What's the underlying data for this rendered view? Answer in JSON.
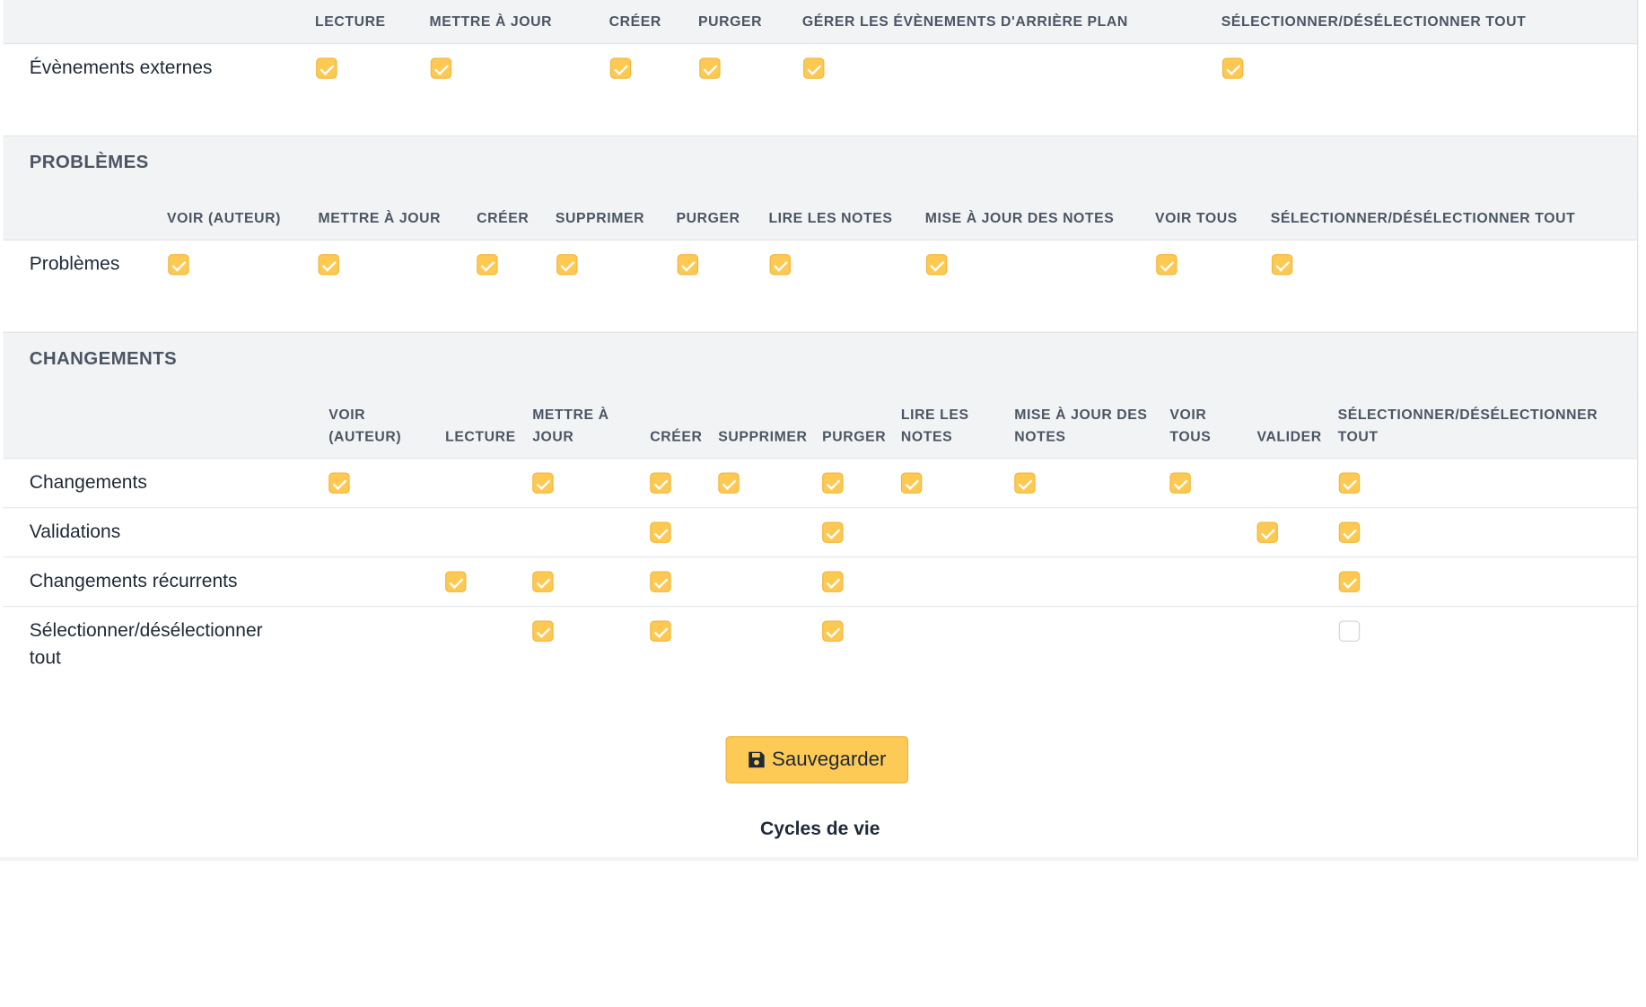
{
  "sections": {
    "external": {
      "columns": [
        "Lecture",
        "Mettre à jour",
        "Créer",
        "Purger",
        "Gérer les évènements d'arrière plan",
        "Sélectionner/désélectionner tout"
      ],
      "rows": [
        {
          "label": "Évènements externes",
          "checks": [
            true,
            true,
            true,
            true,
            true,
            true
          ]
        }
      ]
    },
    "problems": {
      "title": "PROBLÈMES",
      "columns": [
        "Voir (auteur)",
        "Mettre à jour",
        "Créer",
        "Supprimer",
        "Purger",
        "Lire les notes",
        "Mise à jour des notes",
        "Voir tous",
        "Sélectionner/désélectionner tout"
      ],
      "rows": [
        {
          "label": "Problèmes",
          "checks": [
            true,
            true,
            true,
            true,
            true,
            true,
            true,
            true,
            true
          ]
        }
      ]
    },
    "changes": {
      "title": "CHANGEMENTS",
      "columns": [
        [
          "Voir",
          "(auteur)"
        ],
        [
          "",
          "Lecture"
        ],
        [
          "Mettre à",
          "jour"
        ],
        [
          "",
          "Créer"
        ],
        [
          "",
          "Supprimer"
        ],
        [
          "",
          "Purger"
        ],
        [
          "Lire les",
          "notes"
        ],
        [
          "Mise à jour des",
          "notes"
        ],
        [
          "Voir",
          "tous"
        ],
        [
          "",
          "Valider"
        ],
        [
          "Sélectionner/désélectionner",
          "tout"
        ]
      ],
      "rows": [
        {
          "label": "Changements",
          "checks": [
            true,
            null,
            true,
            true,
            true,
            true,
            true,
            true,
            true,
            null,
            true
          ]
        },
        {
          "label": "Validations",
          "checks": [
            null,
            null,
            null,
            true,
            null,
            true,
            null,
            null,
            null,
            true,
            true
          ]
        },
        {
          "label": "Changements récurrents",
          "checks": [
            null,
            true,
            true,
            true,
            null,
            true,
            null,
            null,
            null,
            null,
            true
          ]
        },
        {
          "label": "Sélectionner/désélectionner tout",
          "label_lines": [
            "Sélectionner/désélectionner",
            "tout"
          ],
          "checks": [
            null,
            null,
            true,
            true,
            null,
            true,
            null,
            null,
            null,
            null,
            false
          ]
        }
      ]
    }
  },
  "save_button": {
    "label": "Sauvegarder",
    "icon": "floppy-disk-icon"
  },
  "footer": {
    "title": "Cycles de vie"
  },
  "colors": {
    "accent": "#fdc953",
    "header_bg": "#f2f3f5"
  }
}
